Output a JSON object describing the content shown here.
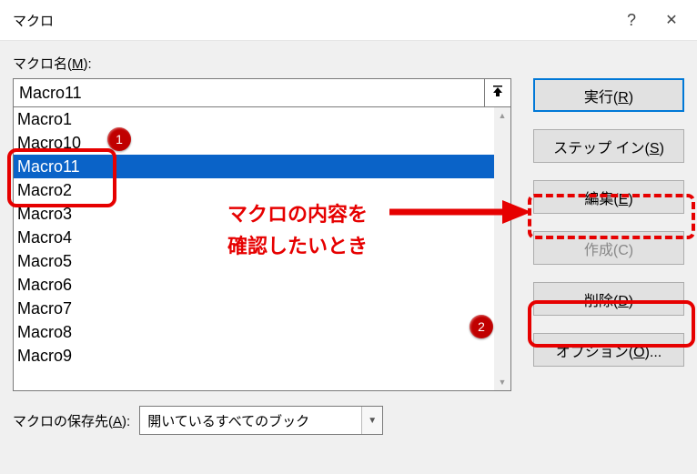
{
  "titlebar": {
    "title": "マクロ",
    "help_symbol": "?",
    "close_symbol": "✕"
  },
  "labels": {
    "macro_name_prefix": "マクロ名(",
    "macro_name_key": "M",
    "macro_name_suffix": "):",
    "save_loc_prefix": "マクロの保存先(",
    "save_loc_key": "A",
    "save_loc_suffix": "):"
  },
  "name_input_value": "Macro11",
  "list_items": [
    {
      "label": "Macro1",
      "selected": false
    },
    {
      "label": "Macro10",
      "selected": false
    },
    {
      "label": "Macro11",
      "selected": true
    },
    {
      "label": "Macro2",
      "selected": false
    },
    {
      "label": "Macro3",
      "selected": false
    },
    {
      "label": "Macro4",
      "selected": false
    },
    {
      "label": "Macro5",
      "selected": false
    },
    {
      "label": "Macro6",
      "selected": false
    },
    {
      "label": "Macro7",
      "selected": false
    },
    {
      "label": "Macro8",
      "selected": false
    },
    {
      "label": "Macro9",
      "selected": false
    }
  ],
  "buttons": {
    "run_prefix": "実行(",
    "run_key": "R",
    "run_suffix": ")",
    "stepin_prefix": "ステップ イン(",
    "stepin_key": "S",
    "stepin_suffix": ")",
    "edit_prefix": "編集(",
    "edit_key": "E",
    "edit_suffix": ")",
    "create_prefix": "作成(",
    "create_key": "C",
    "create_suffix": ")",
    "delete_prefix": "削除(",
    "delete_key": "D",
    "delete_suffix": ")",
    "options_prefix": "オプション(",
    "options_key": "O",
    "options_suffix": ")..."
  },
  "save_location_value": "開いているすべてのブック",
  "annotations": {
    "badge1": "1",
    "badge2": "2",
    "commentary_line1": "マクロの内容を",
    "commentary_line2": "確認したいとき"
  },
  "colors": {
    "highlight_red": "#e60000",
    "selection_blue": "#0a63c8"
  }
}
